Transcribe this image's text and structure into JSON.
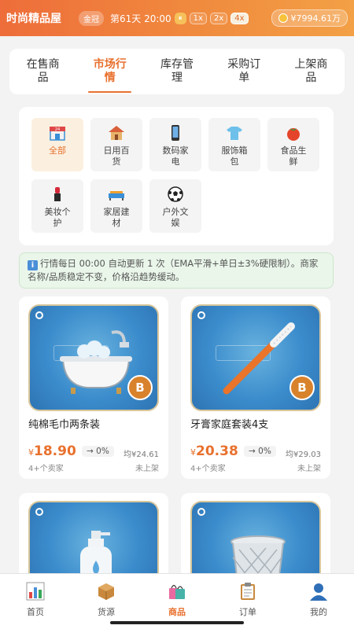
{
  "header": {
    "shop_name": "时尚精品屋",
    "rank": "金冠",
    "day": "第61天 20:00",
    "pause": "⏸",
    "speeds": [
      "1x",
      "2x",
      "4x"
    ],
    "active_speed": "4x",
    "money": "¥7994.61万"
  },
  "tabs": [
    {
      "label": "在售商品"
    },
    {
      "label": "市场行情",
      "active": true
    },
    {
      "label": "库存管理"
    },
    {
      "label": "采购订单"
    },
    {
      "label": "上架商品"
    }
  ],
  "categories": [
    {
      "label": "全部",
      "icon": "store-icon",
      "active": true
    },
    {
      "label": "日用百货",
      "icon": "house-icon"
    },
    {
      "label": "数码家电",
      "icon": "phone-icon"
    },
    {
      "label": "服饰箱包",
      "icon": "tshirt-icon"
    },
    {
      "label": "食品生鲜",
      "icon": "tomato-icon"
    },
    {
      "label": "美妆个护",
      "icon": "lipstick-icon"
    },
    {
      "label": "家居建材",
      "icon": "sofa-icon"
    },
    {
      "label": "户外文娱",
      "icon": "soccer-ball-icon"
    }
  ],
  "notice": {
    "icon": "info-icon",
    "text": "行情每日 00:00 自动更新 1 次（EMA平滑+单日±3%硬限制）。商家名称/品质稳定不变，价格沿趋势缓动。"
  },
  "products": [
    {
      "name": "纯棉毛巾两条装",
      "currency": "¥",
      "price": "18.90",
      "trend": "→ 0%",
      "avg": "均¥24.61",
      "sellers": "4+个卖家",
      "status": "未上架",
      "badge": "B",
      "icon": "bathtub-icon"
    },
    {
      "name": "牙膏家庭套装4支",
      "currency": "¥",
      "price": "20.38",
      "trend": "→ 0%",
      "avg": "均¥29.03",
      "sellers": "4+个卖家",
      "status": "未上架",
      "badge": "B",
      "icon": "toothbrush-icon"
    },
    {
      "name": "",
      "icon": "soap-bottle-icon"
    },
    {
      "name": "",
      "icon": "trash-bin-icon"
    }
  ],
  "nav": [
    {
      "label": "首页",
      "icon": "chart-icon"
    },
    {
      "label": "货源",
      "icon": "package-icon"
    },
    {
      "label": "商品",
      "icon": "shopping-bag-icon",
      "active": true
    },
    {
      "label": "订单",
      "icon": "clipboard-icon"
    },
    {
      "label": "我的",
      "icon": "user-icon"
    }
  ],
  "colors": {
    "accent": "#e8712e",
    "header_start": "#ee6d3a",
    "header_end": "#f3a046",
    "notice_bg": "#eaf6ea"
  }
}
